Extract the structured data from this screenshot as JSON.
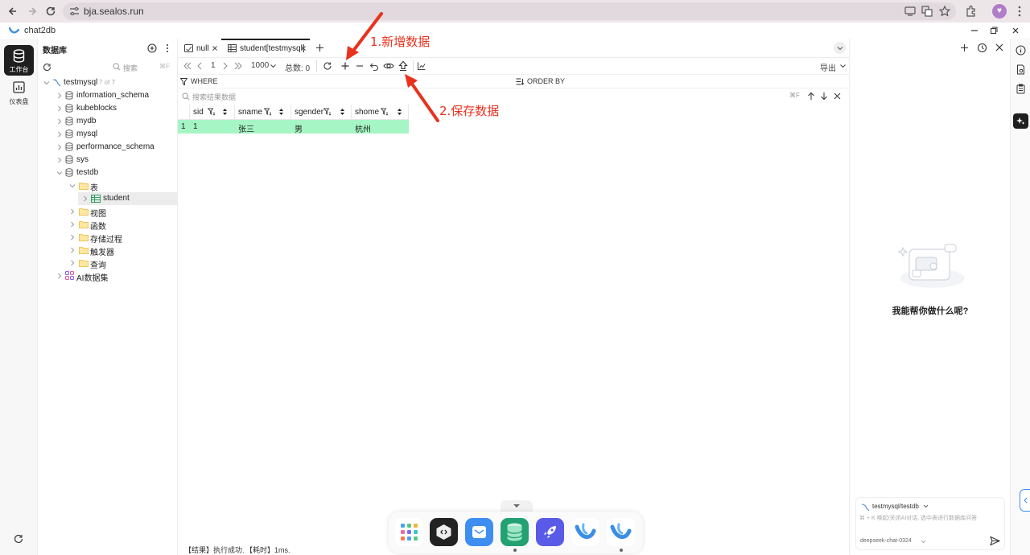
{
  "browser": {
    "url": "bja.sealos.run"
  },
  "app": {
    "name": "chat2db"
  },
  "rail": {
    "items": [
      {
        "label": "工作台"
      },
      {
        "label": "仪表盘"
      }
    ]
  },
  "tree": {
    "title": "数据库",
    "search_placeholder": "搜索",
    "search_shortcut": "⌘F",
    "connection": {
      "name": "testmysql",
      "count": "7 of 7"
    },
    "databases": [
      "information_schema",
      "kubeblocks",
      "mydb",
      "mysql",
      "performance_schema",
      "sys",
      "testdb"
    ],
    "testdb_children": [
      "表",
      "视图",
      "函数",
      "存储过程",
      "触发器",
      "查询"
    ],
    "table": "student",
    "ai_dataset": "AI数据集"
  },
  "tabs": [
    {
      "label": "null"
    },
    {
      "label": "student[testmysql]"
    }
  ],
  "toolbar": {
    "page": "1",
    "page_size": "1000",
    "total_label": "总数: 0",
    "export_label": "导出"
  },
  "filter": {
    "where_label": "WHERE",
    "order_label": "ORDER BY"
  },
  "result_search": {
    "placeholder": "搜索结果数据",
    "shortcut": "⌘F"
  },
  "table": {
    "columns": [
      "sid",
      "sname",
      "sgender",
      "shome"
    ],
    "rows": [
      {
        "index": "1",
        "cells": [
          "1",
          "张三",
          "男",
          "杭州"
        ]
      }
    ],
    "row_color": "#a6f5c4"
  },
  "status": {
    "result": "【结果】执行成功.",
    "time": "【耗时】1ms."
  },
  "ai": {
    "prompt": "我能帮你做什么呢?",
    "context": "testmysql/testdb",
    "input_placeholder": "⌘ + K 唤起/关闭AI对话, 选中表进行数据库问答",
    "model": "deepseek-chat-0324"
  },
  "annotations": {
    "step1": "1.新增数据",
    "step2": "2.保存数据",
    "color": "#e8321e"
  }
}
